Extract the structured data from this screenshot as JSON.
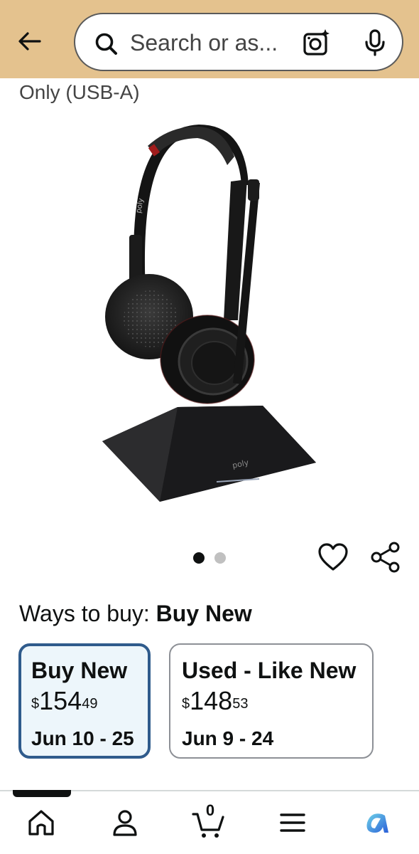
{
  "header": {
    "search_placeholder": "Search or as..."
  },
  "product": {
    "title_fragment": "Only (USB-A)",
    "image_brand_text": "poly"
  },
  "carousel": {
    "total": 2,
    "active_index": 0
  },
  "ways_to_buy": {
    "label": "Ways to buy:",
    "selected": "Buy New"
  },
  "offers": [
    {
      "title": "Buy New",
      "price_symbol": "$",
      "price_whole": "154",
      "price_fraction": "49",
      "delivery": "Jun 10 - 25",
      "selected": true
    },
    {
      "title": "Used - Like New",
      "price_symbol": "$",
      "price_whole": "148",
      "price_fraction": "53",
      "delivery": "Jun 9 - 24",
      "selected": false
    }
  ],
  "bottom_nav": {
    "items": [
      "home-icon",
      "account-icon",
      "cart-icon",
      "menu-icon",
      "rufus-icon"
    ],
    "cart_count": "0",
    "active": "home-icon"
  },
  "colors": {
    "header_bg": "#e4c28e",
    "selected_card_border": "#2f5b8c",
    "selected_card_bg": "#edf6fb",
    "rufus_accent": "#2a8fd8"
  }
}
